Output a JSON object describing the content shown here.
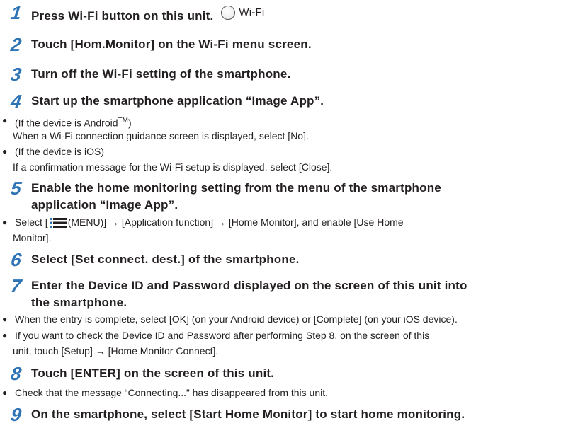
{
  "steps": [
    {
      "num": "1",
      "text": "Press Wi-Fi button on this unit.",
      "badge": "Wi-Fi"
    },
    {
      "num": "2",
      "text": "Touch [Hom.Monitor] on the Wi-Fi menu screen."
    },
    {
      "num": "3",
      "text": "Turn off the Wi-Fi setting of the smartphone."
    },
    {
      "num": "4",
      "text": "Start up the smartphone application “Image App”."
    },
    {
      "num": "5",
      "line1": "Enable the home monitoring setting from the menu of the smartphone",
      "line2": "application “Image App”."
    },
    {
      "num": "6",
      "text": "Select [Set connect. dest.] of the smartphone."
    },
    {
      "num": "7",
      "line1": "Enter the Device ID and Password displayed on the screen of this unit into",
      "line2": "the smartphone."
    },
    {
      "num": "8",
      "text": "Touch [ENTER] on the screen of this unit."
    },
    {
      "num": "9",
      "text": "On the smartphone, select [Start Home Monitor] to start home monitoring."
    }
  ],
  "notes": {
    "step4_android_cond": "(If the device is Android",
    "step4_android_tm": "TM",
    "step4_android_close": ")",
    "step4_android_body": "When a Wi-Fi connection guidance screen is displayed, select [No].",
    "step4_ios_cond": "(If the device is iOS)",
    "step4_ios_body": "If a confirmation message for the Wi-Fi setup is displayed, select [Close].",
    "step5_pre": "Select [",
    "step5_menu": "(MENU)] → [Application function] → [Home Monitor], and enable [Use Home",
    "step5_cont": "Monitor].",
    "step7_a": "When the entry is complete, select [OK] (on your Android device) or [Complete] (on your iOS device).",
    "step7_b1": "If you want to check the Device ID and Password after performing Step 8, on the screen of this",
    "step7_b2": "unit, touch [Setup] → [Home Monitor Connect].",
    "step8_a": "Check that the message “Connecting...” has disappeared from this unit."
  },
  "bullet": "●",
  "colors": {
    "step_number": "#2e74b5",
    "text": "#231f20",
    "menu_icon_dots": "#2e74b5"
  },
  "icons": [
    "wifi-button-circle-icon",
    "menu-icon"
  ]
}
